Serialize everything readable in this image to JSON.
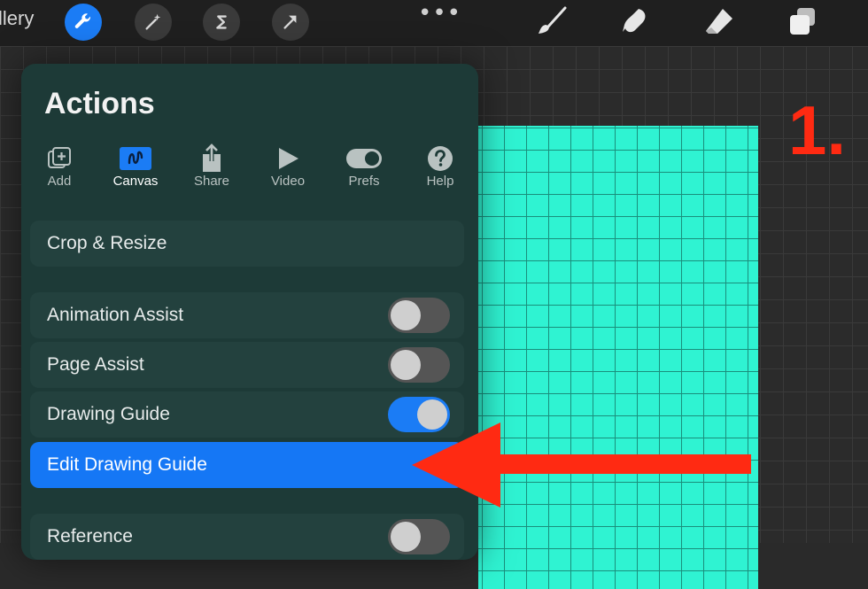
{
  "toolbar": {
    "gallery_label": "llery",
    "more_dots": "•••"
  },
  "panel": {
    "title": "Actions",
    "tabs": [
      {
        "label": "Add"
      },
      {
        "label": "Canvas"
      },
      {
        "label": "Share"
      },
      {
        "label": "Video"
      },
      {
        "label": "Prefs"
      },
      {
        "label": "Help"
      }
    ],
    "items": {
      "crop": "Crop & Resize",
      "animation_assist": "Animation Assist",
      "page_assist": "Page Assist",
      "drawing_guide": "Drawing Guide",
      "edit_drawing_guide": "Edit Drawing Guide",
      "reference": "Reference"
    },
    "toggles": {
      "animation_assist": false,
      "page_assist": false,
      "drawing_guide": true,
      "reference": false
    }
  },
  "annotation": {
    "step_number": "1."
  },
  "colors": {
    "accent": "#1b7cf5",
    "artboard": "#2ff3d2",
    "annotation": "#ff2a12"
  }
}
